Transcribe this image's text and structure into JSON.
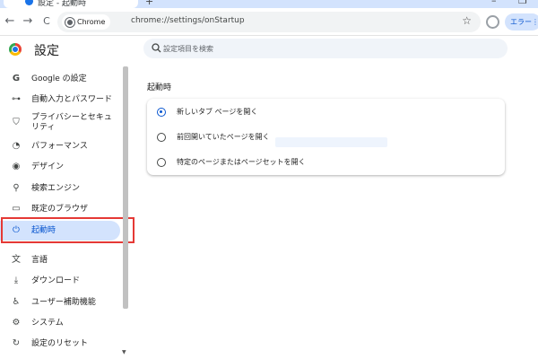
{
  "browser": {
    "tab": {
      "title": "設定 - 起動時"
    },
    "new_tab_symbol": "+",
    "window_controls": {
      "minimize": "–",
      "restore": "❐"
    },
    "nav": {
      "back": "←",
      "forward": "→",
      "reload": "C"
    },
    "omnibox": {
      "chip_label": "Chrome",
      "url": "chrome://settings/onStartup"
    },
    "bookmark_star": "☆",
    "error_button": {
      "label": "エラー⋮"
    }
  },
  "settings": {
    "title": "設定",
    "search": {
      "placeholder": "設定項目を検索"
    },
    "sidebar": {
      "items": [
        {
          "icon": "G",
          "label": "Google の設定"
        },
        {
          "icon": "⊶",
          "label": "自動入力とパスワード"
        },
        {
          "icon": "⛉",
          "label": "プライバシーとセキュリティ"
        },
        {
          "icon": "◔",
          "label": "パフォーマンス"
        },
        {
          "icon": "◉",
          "label": "デザイン"
        },
        {
          "icon": "⚲",
          "label": "検索エンジン"
        },
        {
          "icon": "▭",
          "label": "既定のブラウザ"
        },
        {
          "icon": "⏻",
          "label": "起動時"
        },
        {
          "icon": "文",
          "label": "言語"
        },
        {
          "icon": "⤓",
          "label": "ダウンロード"
        },
        {
          "icon": "♿",
          "label": "ユーザー補助機能"
        },
        {
          "icon": "⚙",
          "label": "システム"
        },
        {
          "icon": "↻",
          "label": "設定のリセット"
        }
      ],
      "active_index": 7
    },
    "startup": {
      "section_title": "起動時",
      "options": [
        {
          "label": "新しいタブ ページを開く",
          "checked": true
        },
        {
          "label": "前回開いていたページを開く",
          "checked": false
        },
        {
          "label": "特定のページまたはページセットを開く",
          "checked": false
        }
      ]
    },
    "colors": {
      "accent": "#0b57d0",
      "active_bg": "#d3e3fd",
      "highlight": "#e53935"
    }
  }
}
